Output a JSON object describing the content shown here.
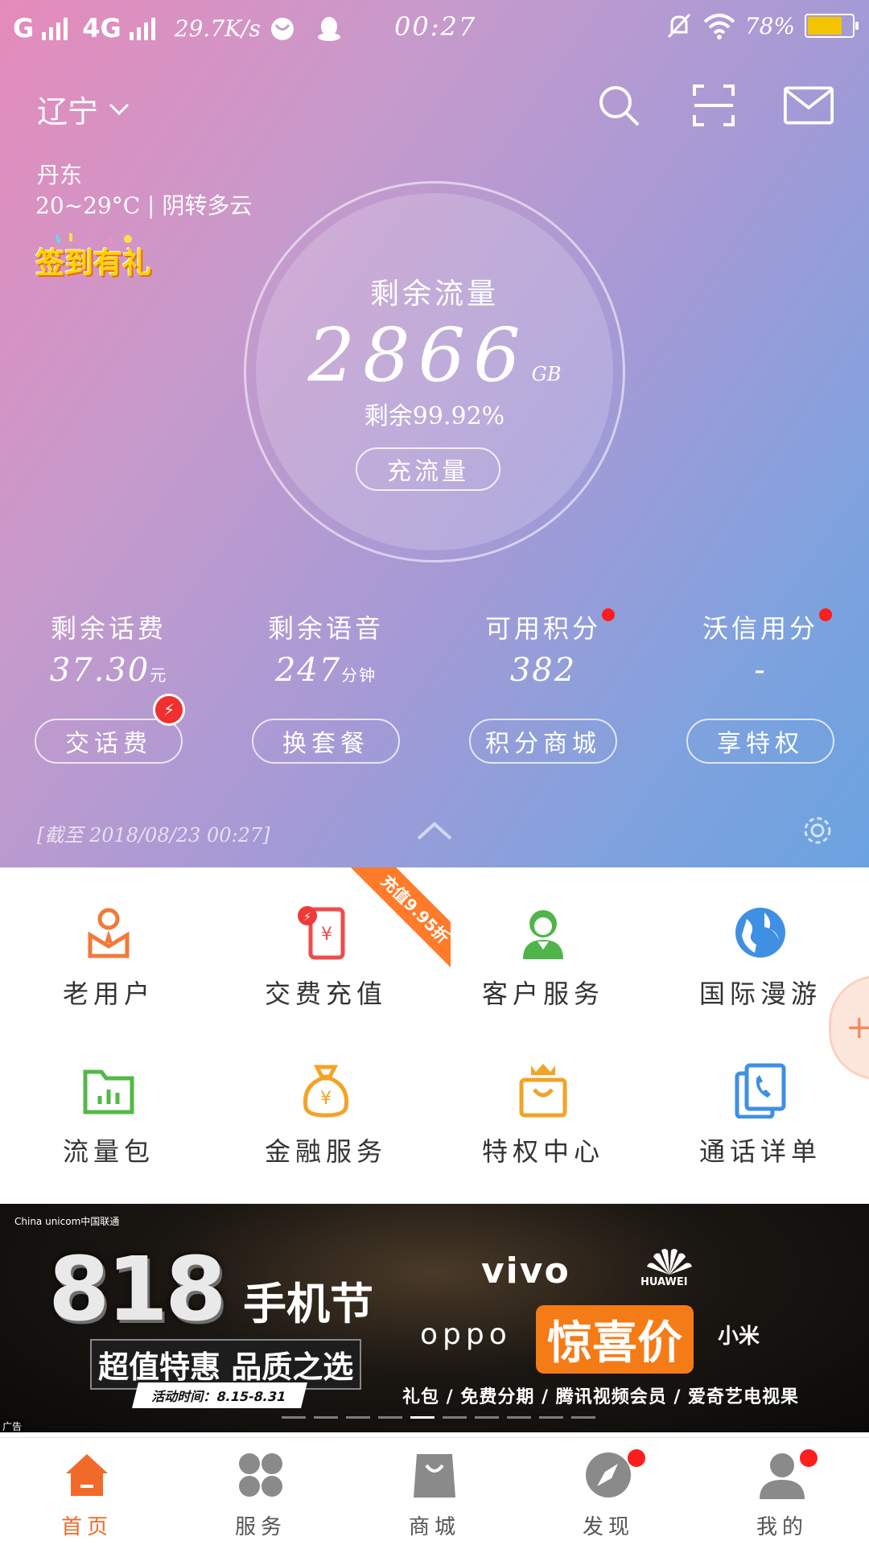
{
  "statusbar": {
    "carrier": "G",
    "network": "4G",
    "speed": "29.7K/s",
    "time": "00:27",
    "battery": "78%",
    "battery_level": 0.78
  },
  "header": {
    "province": "辽宁",
    "city": "丹东",
    "weather": "20~29°C | 阴转多云",
    "signin": "签到有礼"
  },
  "data_circle": {
    "label": "剩余流量",
    "value": "2866",
    "unit": "GB",
    "remaining_pct": "剩余99.92%",
    "button": "充流量"
  },
  "stats": [
    {
      "label": "剩余话费",
      "value": "37.30",
      "unit": "元"
    },
    {
      "label": "剩余语音",
      "value": "247",
      "unit": "分钟"
    },
    {
      "label": "可用积分",
      "value": "382",
      "unit": ""
    },
    {
      "label": "沃信用分",
      "value": "-",
      "unit": ""
    }
  ],
  "actions": [
    "交话费",
    "换套餐",
    "积分商城",
    "享特权"
  ],
  "as_of": "[截至 2018/08/23 00:27]",
  "services": [
    {
      "name": "老用户",
      "icon": "user-badge-icon",
      "color": "#f2793a"
    },
    {
      "name": "交费充值",
      "icon": "phone-yuan-icon",
      "color": "#ef4b4b"
    },
    {
      "name": "客户服务",
      "icon": "customer-service-icon",
      "color": "#4fb54a"
    },
    {
      "name": "国际漫游",
      "icon": "globe-icon",
      "color": "#3f8fe3"
    },
    {
      "name": "流量包",
      "icon": "folder-chart-icon",
      "color": "#53b848"
    },
    {
      "name": "金融服务",
      "icon": "money-bag-icon",
      "color": "#f3a325"
    },
    {
      "name": "特权中心",
      "icon": "crown-bag-icon",
      "color": "#f3a325"
    },
    {
      "name": "通话详单",
      "icon": "call-list-icon",
      "color": "#3f8fe3"
    }
  ],
  "promo_ribbon": "充值9.95折",
  "banner": {
    "brand": "China unicom中国联通",
    "headline_num": "818",
    "headline_text": "手机节",
    "subtitle": "超值特惠 品质之选",
    "date": "活动时间：8.15-8.31",
    "brand_vivo": "vivo",
    "brand_oppo": "oppo",
    "brand_huawei": "HUAWEI",
    "price_tag": "惊喜价",
    "brand_mi": "小米",
    "perks": "礼包 / 免费分期 / 腾讯视频会员 / 爱奇艺电视果",
    "ad_label": "广告"
  },
  "tabs": [
    {
      "label": "首页",
      "icon": "home-icon"
    },
    {
      "label": "服务",
      "icon": "services-icon"
    },
    {
      "label": "商城",
      "icon": "shop-bag-icon"
    },
    {
      "label": "发现",
      "icon": "compass-icon"
    },
    {
      "label": "我的",
      "icon": "profile-icon"
    }
  ],
  "colors": {
    "accent": "#f26a2a",
    "badge_red": "#ff1d1d"
  }
}
